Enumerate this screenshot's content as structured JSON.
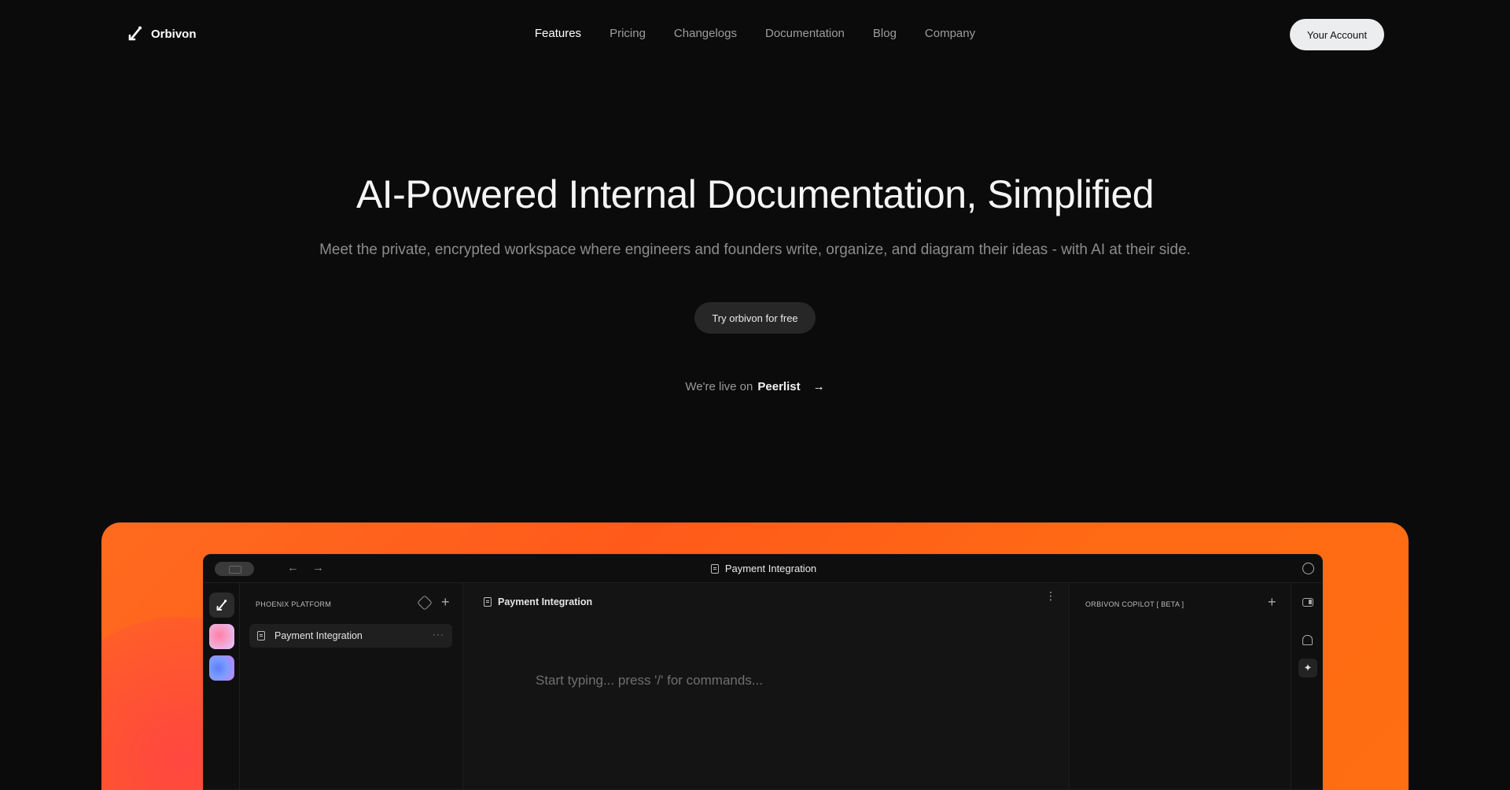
{
  "nav": {
    "brand": "Orbivon",
    "items": [
      {
        "label": "Features",
        "active": true
      },
      {
        "label": "Pricing"
      },
      {
        "label": "Changelogs"
      },
      {
        "label": "Documentation"
      },
      {
        "label": "Blog"
      },
      {
        "label": "Company"
      }
    ],
    "account_label": "Your Account"
  },
  "hero": {
    "title": "AI-Powered Internal Documentation, Simplified",
    "subtitle": "Meet the private, encrypted workspace where engineers and founders write, organize, and diagram their ideas - with AI at their side.",
    "cta_label": "Try orbivon for free",
    "live_prefix": "We're live on",
    "live_brand": "Peerlist",
    "live_arrow": "→"
  },
  "app": {
    "title": "Payment Integration",
    "back_icon": "←",
    "forward_icon": "→",
    "sidebar": {
      "header": "PHOENIX PLATFORM",
      "plus": "+",
      "items": [
        {
          "label": "Payment Integration",
          "more": "···"
        }
      ]
    },
    "editor": {
      "title": "Payment Integration",
      "menu": "⋮",
      "placeholder": "Start typing... press '/' for commands..."
    },
    "copilot": {
      "header": "ORBIVON COPILOT [ BETA ]",
      "plus": "+"
    },
    "colors": {
      "accent": "#ff6a14",
      "background": "#0b0b0b"
    }
  }
}
